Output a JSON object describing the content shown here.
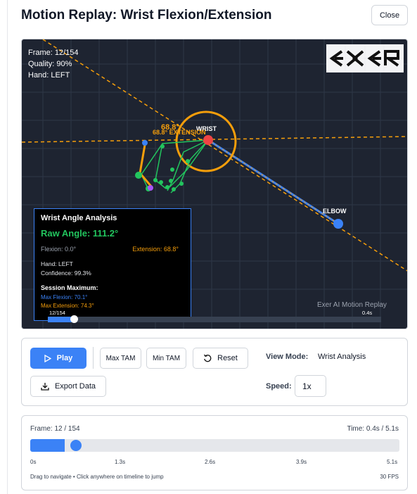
{
  "header": {
    "title": "Motion Replay: Wrist Flexion/Extension",
    "close_label": "Close"
  },
  "viewer": {
    "frame": "Frame: 12/154",
    "quality": "Quality: 90%",
    "hand": "Hand: LEFT",
    "logo_text": "EXER",
    "wrist_label": "WRIST",
    "elbow_label": "ELBOW",
    "angle_value": "68.8°",
    "angle_label": "68.8° EXTENSION",
    "watermark": "Exer AI Motion Replay",
    "mini_frame": "12/154",
    "mini_time": "0.4s",
    "mini_progress": 0.078
  },
  "analysis": {
    "title": "Wrist Angle Analysis",
    "raw_angle": "Raw Angle: 111.2°",
    "flexion": "Flexion: 0.0°",
    "extension": "Extension: 68.8°",
    "hand": "Hand: LEFT",
    "confidence": "Confidence: 99.3%",
    "session_max_title": "Session Maximum:",
    "max_flexion": "Max Flexion: 70.1°",
    "max_extension": "Max Extension: 74.3°"
  },
  "controls": {
    "play_label": "Play",
    "max_tam_label": "Max TAM",
    "min_tam_label": "Min TAM",
    "reset_label": "Reset",
    "export_label": "Export Data",
    "view_mode_label": "View Mode:",
    "view_mode_value": "Wrist Analysis",
    "speed_label": "Speed:",
    "speed_value": "1x"
  },
  "timeline": {
    "frame_text": "Frame: 12 / 154",
    "time_text": "Time: 0.4s / 5.1s",
    "progress": 0.078,
    "ticks": [
      "0s",
      "1.3s",
      "2.6s",
      "3.9s",
      "5.1s"
    ],
    "hint": "Drag to navigate • Click anywhere on timeline to jump",
    "fps": "30 FPS"
  },
  "colors": {
    "accent": "#3b82f6",
    "orange": "#f59e0b",
    "green": "#22c55e",
    "viewer_bg": "#1e2431"
  }
}
